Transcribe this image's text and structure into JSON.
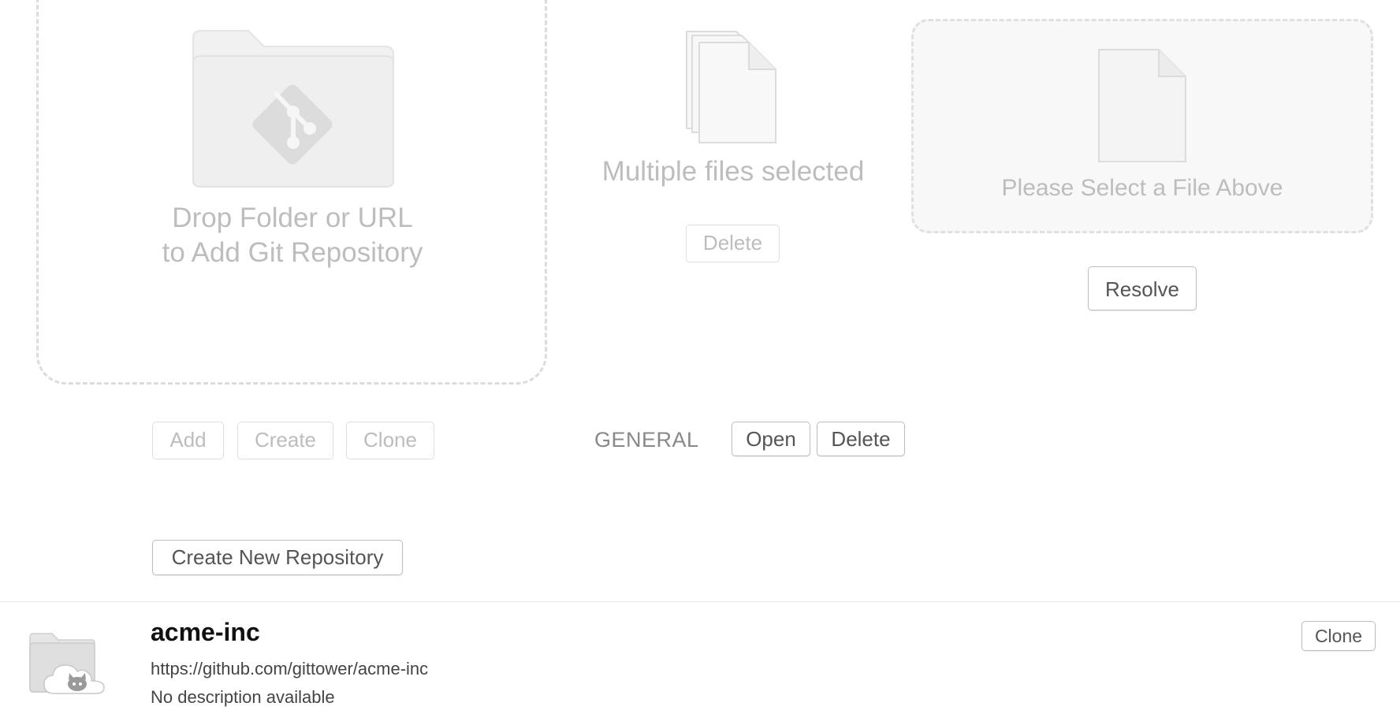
{
  "drop_zone": {
    "line1": "Drop Folder or URL",
    "line2": "to Add Git Repository",
    "icon": "git-folder-icon"
  },
  "repo_actions": {
    "add_label": "Add",
    "create_label": "Create",
    "clone_label": "Clone"
  },
  "multi_select": {
    "text": "Multiple files selected",
    "delete_label": "Delete",
    "icon": "multiple-files-icon"
  },
  "conflict": {
    "placeholder": "Please Select a File Above",
    "resolve_label": "Resolve",
    "icon": "file-icon"
  },
  "general": {
    "label": "GENERAL",
    "open_label": "Open",
    "delete_label": "Delete"
  },
  "create_new_label": "Create New Repository",
  "remote_repo": {
    "name": "acme-inc",
    "url": "https://github.com/gittower/acme-inc",
    "description": "No description available",
    "clone_label": "Clone",
    "icon": "github-cloud-folder-icon"
  },
  "colors": {
    "placeholder_gray": "#bdbdbd",
    "border_gray": "#dcdcdc",
    "text_dark": "#111111"
  }
}
